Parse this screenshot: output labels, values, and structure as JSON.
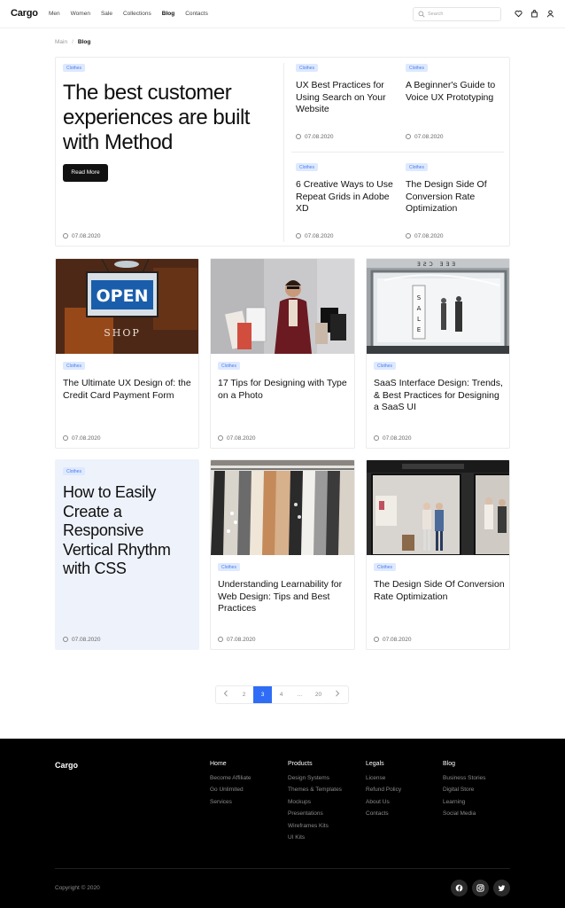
{
  "header": {
    "logo": "Cargo",
    "nav": [
      "Men",
      "Women",
      "Sale",
      "Collections",
      "Blog",
      "Contacts"
    ],
    "active_nav": "Blog",
    "search_placeholder": "Search",
    "icons": [
      "heart-icon",
      "bag-icon",
      "user-icon"
    ]
  },
  "breadcrumb": {
    "root": "Main",
    "separator": "/",
    "current": "Blog"
  },
  "hero": {
    "tag": "Clothes",
    "title": "The best customer experiences are built with Method",
    "button": "Read More",
    "date": "07.08.2020",
    "side_posts": [
      {
        "tag": "Clothes",
        "title": "UX Best Practices for Using Search on Your Website",
        "date": "07.08.2020"
      },
      {
        "tag": "Clothes",
        "title": "A Beginner's Guide to Voice UX Prototyping",
        "date": "07.08.2020"
      },
      {
        "tag": "Clothes",
        "title": "6 Creative Ways to Use Repeat Grids in Adobe XD",
        "date": "07.08.2020"
      },
      {
        "tag": "Clothes",
        "title": "The Design Side Of Conversion Rate Optimization",
        "date": "07.08.2020"
      }
    ]
  },
  "posts": [
    {
      "tag": "Clothes",
      "title": "The Ultimate UX Design of: the Credit Card Payment Form",
      "date": "07.08.2020",
      "image": "open-shop-sign"
    },
    {
      "tag": "Clothes",
      "title": "17 Tips for Designing with Type on a Photo",
      "date": "07.08.2020",
      "image": "woman-shopping-bags"
    },
    {
      "tag": "Clothes",
      "title": "SaaS Interface Design: Trends, & Best Practices for Designing a SaaS UI",
      "date": "07.08.2020",
      "image": "sale-storefront"
    },
    {
      "tag": "Clothes",
      "title": "How to Easily Create a Responsive Vertical Rhythm with CSS",
      "date": "07.08.2020",
      "image": ""
    },
    {
      "tag": "Clothes",
      "title": "Understanding Learnability for Web Design: Tips and Best Practices",
      "date": "07.08.2020",
      "image": "clothing-rack"
    },
    {
      "tag": "Clothes",
      "title": "The Design Side Of Conversion Rate Optimization",
      "date": "07.08.2020",
      "image": "shop-window-mannequins"
    }
  ],
  "images": {
    "open_sign_text": "OPEN",
    "shop_text": "SHOP",
    "sale_text": "SALE"
  },
  "pagination": {
    "pages": [
      "2",
      "3",
      "4",
      "...",
      "20"
    ],
    "current": "3",
    "prev_icon": "chevron-left-icon",
    "next_icon": "chevron-right-icon"
  },
  "footer": {
    "logo": "Cargo",
    "columns": [
      {
        "title": "Home",
        "links": [
          "Become Affiliate",
          "Go Unlimited",
          "Services"
        ]
      },
      {
        "title": "Products",
        "links": [
          "Design Systems",
          "Themes & Templates",
          "Mockups",
          "Presentations",
          "Wireframes Kits",
          "UI Kits"
        ]
      },
      {
        "title": "Legals",
        "links": [
          "License",
          "Refund Policy",
          "About Us",
          "Contacts"
        ]
      },
      {
        "title": "Blog",
        "links": [
          "Business Stories",
          "Digital Store",
          "Learning",
          "Social Media"
        ]
      }
    ],
    "copyright": "Copyright © 2020",
    "social": [
      "facebook-icon",
      "instagram-icon",
      "twitter-icon"
    ]
  },
  "colors": {
    "accent": "#2f6df6",
    "tag_bg": "#dde9ff",
    "tag_text": "#4b7be8",
    "footer_bg": "#000000",
    "highlight_card": "#eef2fb"
  }
}
